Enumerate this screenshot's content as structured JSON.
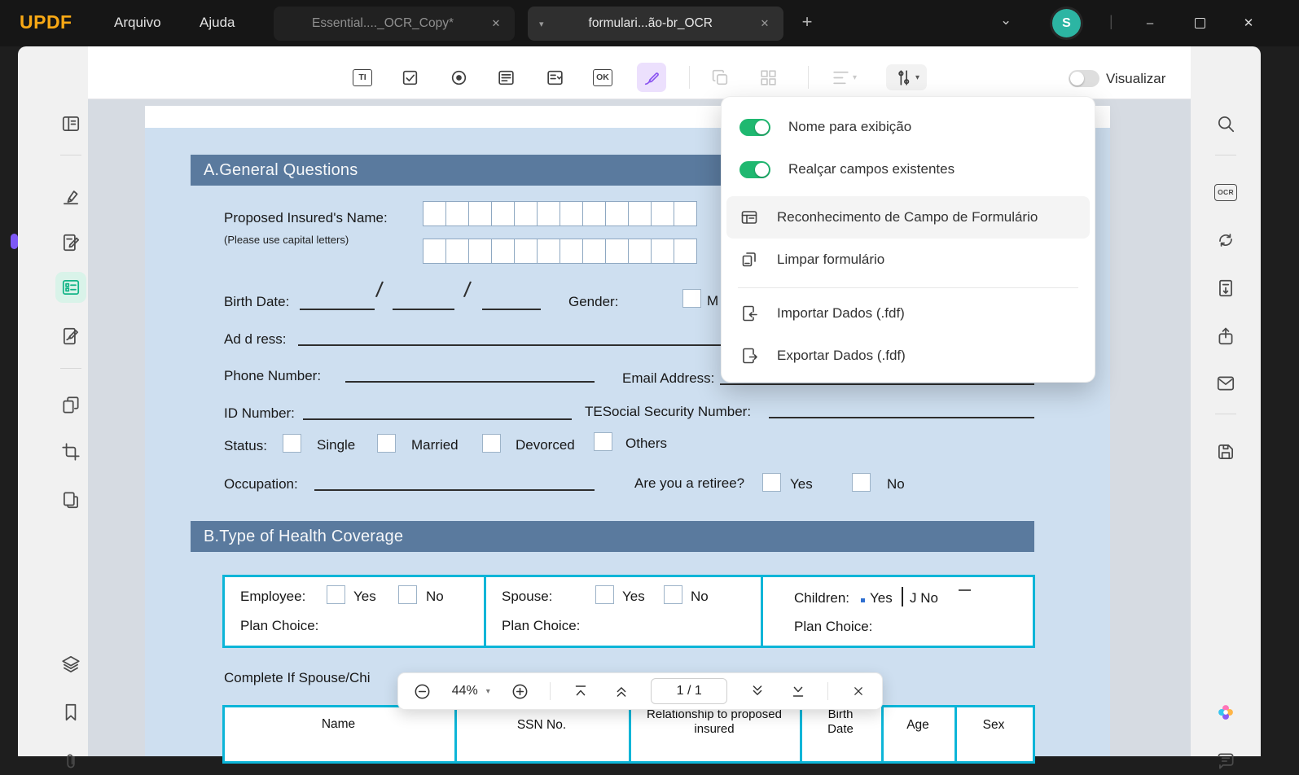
{
  "titlebar": {
    "logo": "UPDF",
    "menu_arquivo": "Arquivo",
    "menu_ajuda": "Ajuda",
    "tab1": "Essential...._OCR_Copy*",
    "tab2": "formulari...ão-br_OCR",
    "new_tab": "+",
    "avatar_initial": "S"
  },
  "toolbar": {
    "text_field_glyph": "TI",
    "push_button_glyph": "OK",
    "visualize_label": "Visualizar",
    "icons": [
      "text-field",
      "checkbox",
      "radio-button",
      "list-box",
      "combo-box",
      "push-button",
      "signature-field",
      "copy-fields",
      "arrange-fields",
      "align-fields",
      "form-tools"
    ]
  },
  "left_sidebar": {
    "icons": [
      "thumbnails",
      "highlighter",
      "annotate",
      "form-fields",
      "sign",
      "organize-pages",
      "crop",
      "extract-pages",
      "layers",
      "bookmark",
      "attachment"
    ]
  },
  "right_sidebar": {
    "ocr_label": "OCR",
    "icons": [
      "search",
      "ocr",
      "convert",
      "extract-page",
      "share",
      "email",
      "save",
      "ai-assistant",
      "comment"
    ]
  },
  "form_menu": {
    "toggle_display_name": "Nome para exibição",
    "toggle_highlight_fields": "Realçar campos existentes",
    "item_field_recognition": "Reconhecimento de Campo de Formulário",
    "item_clear_form": "Limpar formulário",
    "item_import": "Importar Dados (.fdf)",
    "item_export": "Exportar Dados (.fdf)"
  },
  "zoombar": {
    "zoom_level": "44%",
    "page_indicator": "1 / 1"
  },
  "document": {
    "section_a": "A.General Questions",
    "proposed_name_label": "Proposed Insured's Name:",
    "capital_letters_hint": "(Please use capital letters)",
    "birth_date_label": "Birth Date:",
    "gender_label": "Gender:",
    "gender_option_m": "M",
    "address_label": "Ad d ress:",
    "phone_label": "Phone Number:",
    "email_label": "Email Address:",
    "id_label": "ID Number:",
    "ssn_label": "TESocial Security Number:",
    "status_label": "Status:",
    "status_options": [
      "Single",
      "Married",
      "Devorced",
      "Others"
    ],
    "occupation_label": "Occupation:",
    "retiree_label": "Are you a retiree?",
    "yes_label": "Yes",
    "no_label": "No",
    "section_b": "B.Type of Health Coverage",
    "employee_label": "Employee:",
    "spouse_label": "Spouse:",
    "children_label": "Children:",
    "children_yes": "Yes",
    "children_no": "J No",
    "plan_choice_label": "Plan Choice:",
    "complete_line": "Complete If Spouse/Chi",
    "table_headers": [
      "Name",
      "SSN No.",
      "Relationship to proposed insured",
      "Birth Date",
      "Age",
      "Sex"
    ]
  },
  "colors": {
    "accent_green": "#1fb870",
    "active_tool_purple": "#8a53f0",
    "active_nav_green": "#12b487",
    "section_bar_blue": "#5a7a9e",
    "table_border_cyan": "#0cb5d8",
    "logo_orange": "#f7a815",
    "avatar_teal": "#2cb5a3"
  }
}
